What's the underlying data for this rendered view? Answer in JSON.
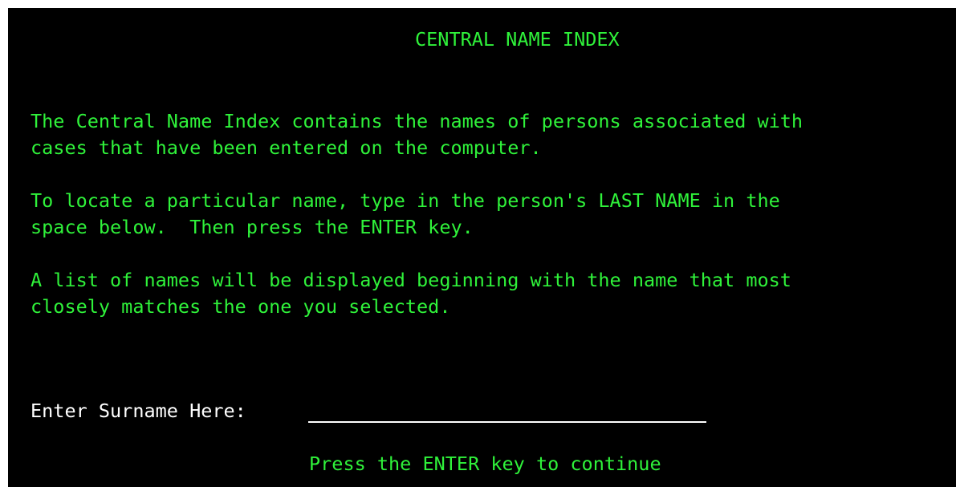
{
  "screen": {
    "title": "CENTRAL NAME INDEX",
    "paragraphs": [
      {
        "line1": "The Central Name Index contains the names of persons associated with",
        "line2": "cases that have been entered on the computer."
      },
      {
        "line1": "To locate a particular name, type in the person's LAST NAME in the",
        "line2": "space below.  Then press the ENTER key."
      },
      {
        "line1": "A list of names will be displayed beginning with the name that most",
        "line2": "closely matches the one you selected."
      }
    ],
    "surname_label": "Enter Surname Here:",
    "surname_value": "",
    "continue_message": "Press the ENTER key to continue"
  },
  "colors": {
    "background": "#000000",
    "text_green": "#2ff23a",
    "text_white": "#ffffff"
  }
}
